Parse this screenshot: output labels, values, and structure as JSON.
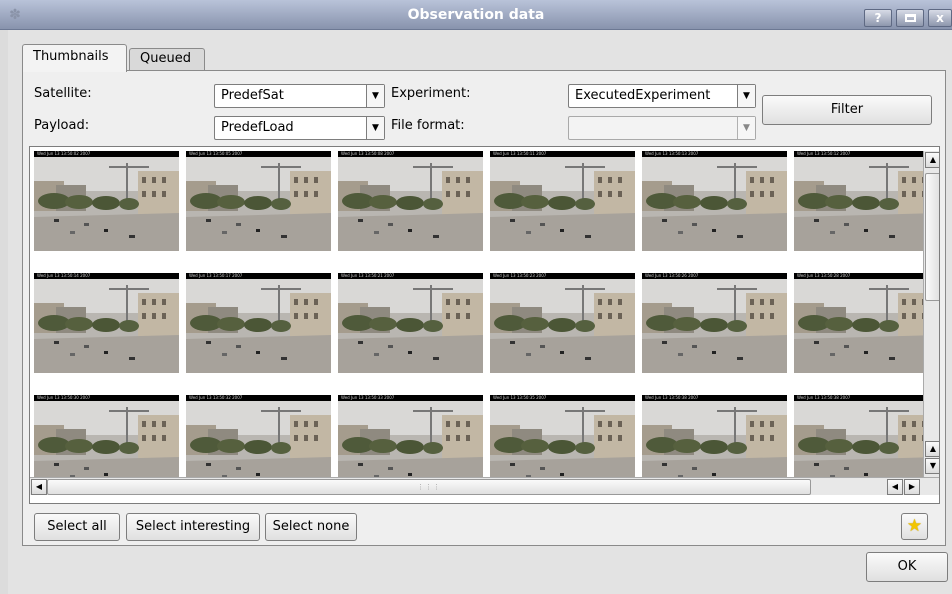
{
  "window": {
    "title": "Observation data",
    "help_label": "?",
    "close_label": "x"
  },
  "tabs": [
    {
      "label": "Thumbnails",
      "active": true
    },
    {
      "label": "Queued",
      "active": false
    }
  ],
  "filters": {
    "satellite_label": "Satellite:",
    "satellite_value": "PredefSat",
    "payload_label": "Payload:",
    "payload_value": "PredefLoad",
    "experiment_label": "Experiment:",
    "experiment_value": "ExecutedExperiment",
    "file_format_label": "File format:",
    "file_format_value": "",
    "filter_button": "Filter"
  },
  "thumbnails": {
    "captions": [
      [
        "Wed Jun 13 13:50:02 2007",
        "Wed Jun 13 13:50:05 2007",
        "Wed Jun 13 13:50:08 2007",
        "Wed Jun 13 13:50:11 2007",
        "Wed Jun 13 13:50:13 2007",
        "Wed Jun 13 13:50:12 2007"
      ],
      [
        "Wed Jun 13 13:50:14 2007",
        "Wed Jun 13 13:50:17 2007",
        "Wed Jun 13 13:50:21 2007",
        "Wed Jun 13 13:50:23 2007",
        "Wed Jun 13 13:50:26 2007",
        "Wed Jun 13 13:50:28 2007"
      ],
      [
        "Wed Jun 13 13:50:30 2007",
        "Wed Jun 13 13:50:32 2007",
        "Wed Jun 13 13:50:33 2007",
        "Wed Jun 13 13:50:35 2007",
        "Wed Jun 13 13:50:38 2007",
        "Wed Jun 13 13:50:38 2007"
      ]
    ]
  },
  "actions": {
    "select_all": "Select all",
    "select_interesting": "Select interesting",
    "select_none": "Select none",
    "ok": "OK"
  },
  "icons": {
    "star": "star-icon",
    "scroll_up": "arrow-up-icon",
    "scroll_down": "arrow-down-icon",
    "scroll_left": "arrow-left-icon",
    "scroll_right": "arrow-right-icon",
    "combo_arrow": "chevron-down-icon"
  },
  "colors": {
    "titlebar": "#8893ad",
    "star": "#f2c500"
  }
}
